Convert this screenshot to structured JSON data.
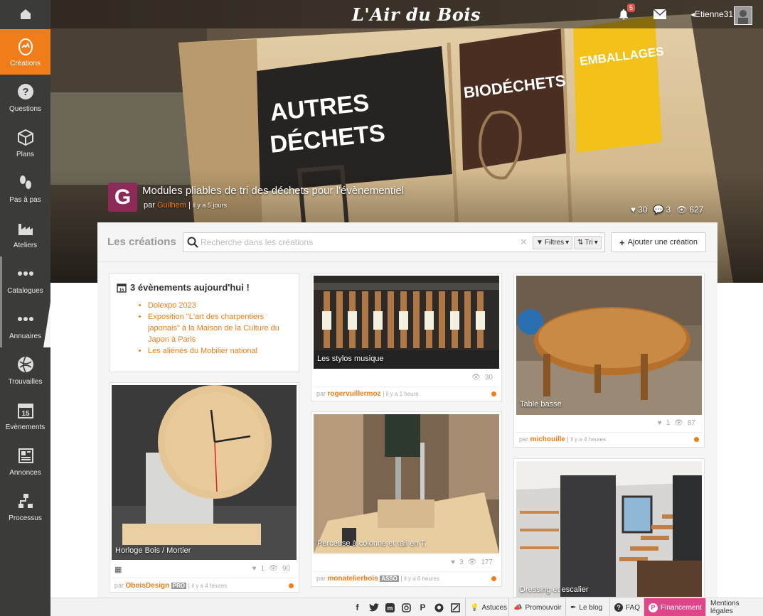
{
  "app": {
    "brand": "L'Air du Bois"
  },
  "sidebar": {
    "items": [
      {
        "label": "Créations",
        "icon": "egg-icon"
      },
      {
        "label": "Questions",
        "icon": "question-icon"
      },
      {
        "label": "Plans",
        "icon": "cube-icon"
      },
      {
        "label": "Pas à pas",
        "icon": "footsteps-icon"
      },
      {
        "label": "Ateliers",
        "icon": "factory-icon"
      },
      {
        "label": "Catalogues",
        "icon": "dots-icon"
      },
      {
        "label": "Annuaires",
        "icon": "dots-icon"
      },
      {
        "label": "Trouvailles",
        "icon": "globe-icon"
      },
      {
        "label": "Evènements",
        "icon": "calendar-icon"
      },
      {
        "label": "Annonces",
        "icon": "newspaper-icon"
      },
      {
        "label": "Processus",
        "icon": "flowchart-icon"
      }
    ]
  },
  "topbar": {
    "notif_count": "5",
    "username": "Etienne31"
  },
  "featured": {
    "logo_letter": "G",
    "title": "Modules pliables de tri des déchets pour l'évènementiel",
    "by": "par",
    "author": "Guilhem",
    "time": "il y a 5 jours",
    "likes": "30",
    "comments": "3",
    "views": "627",
    "sign_texts": {
      "autres": "AUTRES DÉCHETS",
      "bio": "BIODÉCHETS",
      "emb": "EMBALLAGES"
    }
  },
  "panel": {
    "title": "Les créations",
    "search_placeholder": "Recherche dans les créations",
    "filters_label": "Filtres",
    "sort_label": "Tri",
    "add_label": "Ajouter une création"
  },
  "events": {
    "title": "3 évènements aujourd'hui !",
    "items": [
      "Dolexpo 2023",
      "Exposition \"L'art des charpentiers japonais\" à la Maison de la Culture du Japon à Paris",
      "Les aliénés du Mobilier national"
    ]
  },
  "cards": [
    {
      "caption": "Horloge Bois / Mortier",
      "likes": "1",
      "views": "90",
      "by": "par",
      "author": "OboisDesign",
      "badge": "PRO",
      "time": "il y a 4 heures"
    },
    {
      "caption": "Les stylos musique",
      "views": "30",
      "by": "par",
      "author": "rogervuillermoz",
      "time": "il y a 1 heure"
    },
    {
      "caption": "Perceuse à colonne et rail en T.",
      "likes": "3",
      "views": "177",
      "by": "par",
      "author": "monatelierbois",
      "badge": "ASSO",
      "time": "il y a 6 heures"
    },
    {
      "caption": "Table basse",
      "likes": "1",
      "views": "87",
      "by": "par",
      "author": "michouille",
      "time": "il y a 4 heures"
    },
    {
      "caption": "Dressing et escalier"
    }
  ],
  "footer": {
    "social": [
      "facebook-icon",
      "twitter-icon",
      "mastodon-icon",
      "instagram-icon",
      "pinterest-icon",
      "github-icon",
      "blog-feed-icon"
    ],
    "astuces": "Astuces",
    "promouvoir": "Promouvoir",
    "blog": "Le blog",
    "faq": "FAQ",
    "financement": "Financement",
    "mentions": "Mentions légales"
  },
  "colors": {
    "accent": "#f07d1a",
    "sidebar": "#3b3b39",
    "financement": "#e0458a"
  }
}
